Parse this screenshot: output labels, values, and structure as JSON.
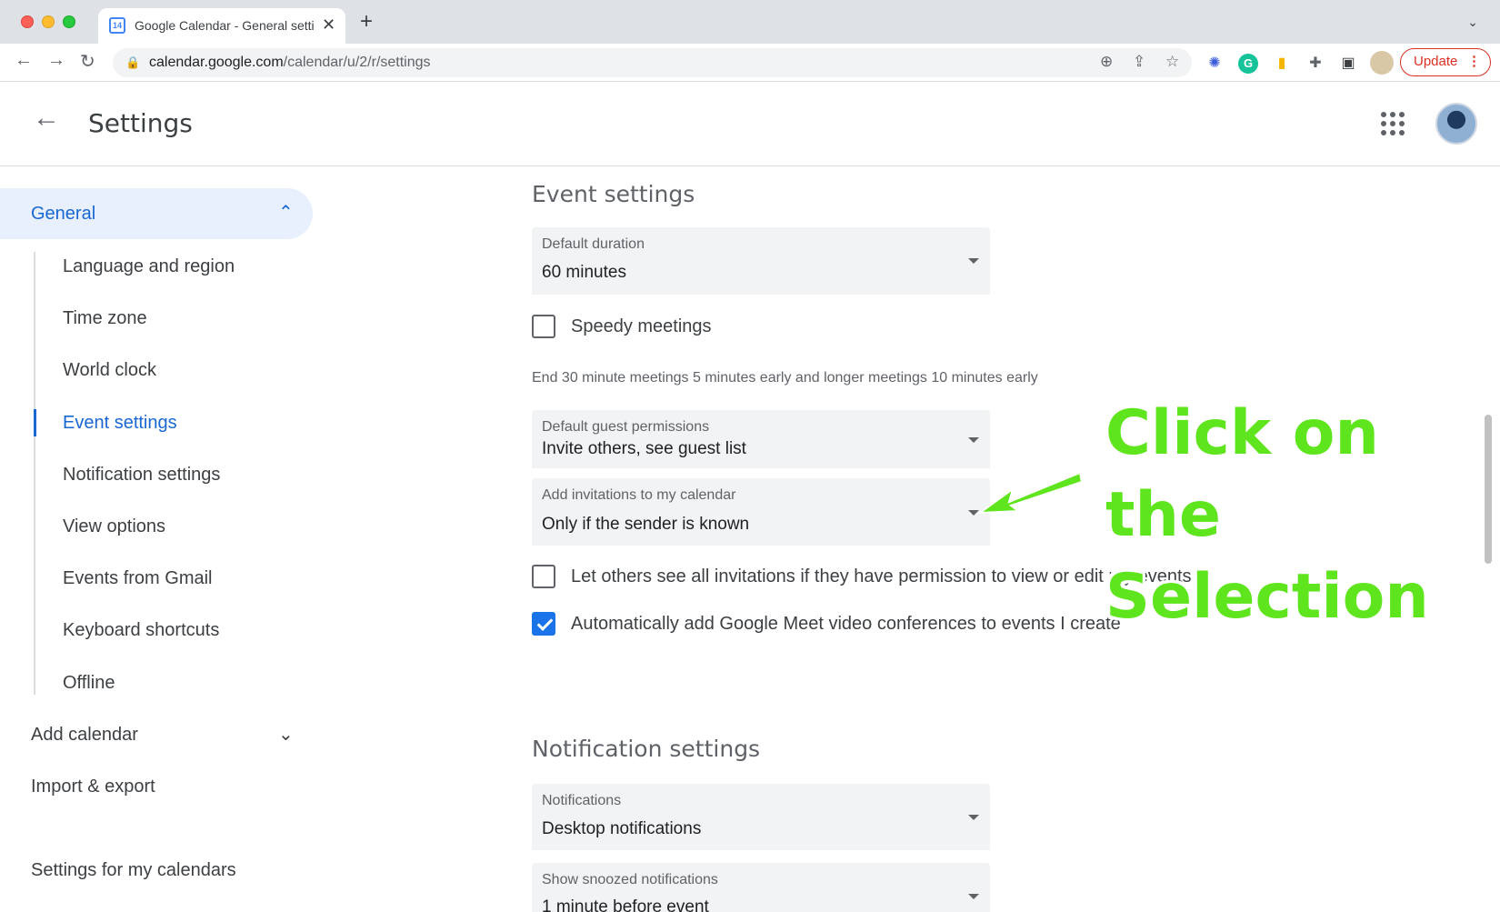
{
  "browser": {
    "tab_title": "Google Calendar - General setti",
    "favicon_text": "14",
    "tab_close": "✕",
    "new_tab": "+",
    "tab_search": "⌄",
    "url_host": "calendar.google.com",
    "url_path": "/calendar/u/2/r/settings",
    "update_label": "Update",
    "update_menu": "⋮",
    "back": "←",
    "forward": "→",
    "reload": "↻",
    "lock": "🔒",
    "zoom": "⊕",
    "share": "⇪",
    "star": "☆",
    "extensions": [
      {
        "name": "snowflake-extension-icon",
        "glyph": "✺",
        "color": "#3b5bdb"
      },
      {
        "name": "grammarly-extension-icon",
        "glyph": "G",
        "color": "#15c39a"
      },
      {
        "name": "badge-extension-icon",
        "glyph": "▮",
        "color": "#f4b400"
      },
      {
        "name": "puzzle-extensions-icon",
        "glyph": "✚",
        "color": "#5f6368"
      },
      {
        "name": "side-panel-icon",
        "glyph": "▣",
        "color": "#3c4043"
      }
    ]
  },
  "header": {
    "back_arrow": "←",
    "title": "Settings"
  },
  "sidebar": {
    "general": "General",
    "general_chevron": "⌃",
    "sub_items": [
      {
        "label": "Language and region",
        "active": false
      },
      {
        "label": "Time zone",
        "active": false
      },
      {
        "label": "World clock",
        "active": false
      },
      {
        "label": "Event settings",
        "active": true
      },
      {
        "label": "Notification settings",
        "active": false
      },
      {
        "label": "View options",
        "active": false
      },
      {
        "label": "Events from Gmail",
        "active": false
      },
      {
        "label": "Keyboard shortcuts",
        "active": false
      },
      {
        "label": "Offline",
        "active": false
      }
    ],
    "add_calendar": "Add calendar",
    "add_calendar_chevron": "⌄",
    "import_export": "Import & export",
    "settings_for_my_calendars": "Settings for my calendars"
  },
  "main": {
    "event_settings_title": "Event settings",
    "default_duration": {
      "label": "Default duration",
      "value": "60 minutes"
    },
    "speedy_meetings": {
      "label": "Speedy meetings",
      "checked": false
    },
    "speedy_helper": "End 30 minute meetings 5 minutes early and longer meetings 10 minutes early",
    "guest_permissions": {
      "label": "Default guest permissions",
      "value": "Invite others, see guest list"
    },
    "add_invitations": {
      "label": "Add invitations to my calendar",
      "value": "Only if the sender is known"
    },
    "let_others_see": {
      "label": "Let others see all invitations if they have permission to view or edit my events",
      "checked": false
    },
    "auto_meet": {
      "label": "Automatically add Google Meet video conferences to events I create",
      "checked": true
    },
    "notification_settings_title": "Notification settings",
    "notifications": {
      "label": "Notifications",
      "value": "Desktop notifications"
    },
    "snoozed": {
      "label": "Show snoozed notifications",
      "value": "1 minute before event"
    }
  },
  "annotation": {
    "line1": "Click on the",
    "line2": "Selection",
    "color": "#5ee51d"
  }
}
